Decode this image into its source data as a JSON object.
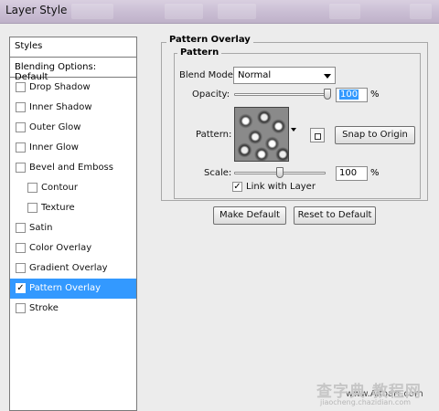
{
  "window": {
    "title": "Layer Style"
  },
  "styles_panel": {
    "header": "Styles",
    "blending_options": "Blending Options: Default",
    "items": [
      {
        "label": "Drop Shadow",
        "checked": false,
        "indent": false,
        "selected": false
      },
      {
        "label": "Inner Shadow",
        "checked": false,
        "indent": false,
        "selected": false
      },
      {
        "label": "Outer Glow",
        "checked": false,
        "indent": false,
        "selected": false
      },
      {
        "label": "Inner Glow",
        "checked": false,
        "indent": false,
        "selected": false
      },
      {
        "label": "Bevel and Emboss",
        "checked": false,
        "indent": false,
        "selected": false
      },
      {
        "label": "Contour",
        "checked": false,
        "indent": true,
        "selected": false
      },
      {
        "label": "Texture",
        "checked": false,
        "indent": true,
        "selected": false
      },
      {
        "label": "Satin",
        "checked": false,
        "indent": false,
        "selected": false
      },
      {
        "label": "Color Overlay",
        "checked": false,
        "indent": false,
        "selected": false
      },
      {
        "label": "Gradient Overlay",
        "checked": false,
        "indent": false,
        "selected": false
      },
      {
        "label": "Pattern Overlay",
        "checked": true,
        "indent": false,
        "selected": true
      },
      {
        "label": "Stroke",
        "checked": false,
        "indent": false,
        "selected": false
      }
    ]
  },
  "pattern_overlay": {
    "section_title": "Pattern Overlay",
    "group_title": "Pattern",
    "blend_mode_label": "Blend Mode:",
    "blend_mode_value": "Normal",
    "opacity_label": "Opacity:",
    "opacity_value": "100",
    "opacity_unit": "%",
    "opacity_level": 100,
    "pattern_label": "Pattern:",
    "snap_button": "Snap to Origin",
    "scale_label": "Scale:",
    "scale_value": "100",
    "scale_unit": "%",
    "scale_level": 100,
    "link_label": "Link with Layer",
    "link_checked": true
  },
  "buttons": {
    "make_default": "Make Default",
    "reset_default": "Reset to Default"
  },
  "watermark": {
    "url": "www.Alfoart.com",
    "site_big": "查字典 教程网",
    "site_small": "jiaocheng.chazidian.com"
  },
  "colors": {
    "selection": "#3399ff",
    "dialog_bg": "#ececec"
  }
}
